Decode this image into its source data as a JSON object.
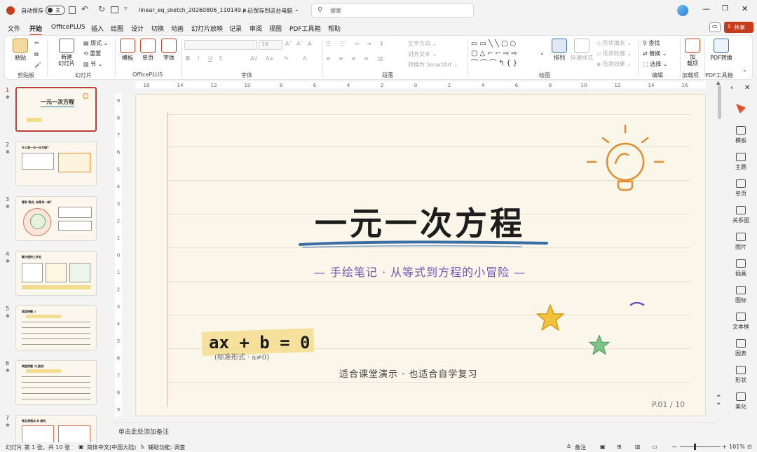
{
  "titlebar": {
    "autosave_label": "自动保存",
    "autosave_state": "关",
    "filename": "linear_eq_sketch_20260806_110149.p...",
    "save_status": "• 已保存到这台电脑",
    "search_placeholder": "搜索",
    "app_color": "#c43e1c"
  },
  "tabs": [
    "文件",
    "开始",
    "OfficePLUS",
    "插入",
    "绘图",
    "设计",
    "切换",
    "动画",
    "幻灯片放映",
    "记录",
    "审阅",
    "视图",
    "PDF工具箱",
    "帮助"
  ],
  "share_label": "共享",
  "ribbon": {
    "clipboard": {
      "paste": "粘贴",
      "group": "剪贴板"
    },
    "slides": {
      "new_slide": "新建\n幻灯片",
      "layout": "版式",
      "reset": "重置",
      "section": "节",
      "group": "幻灯片"
    },
    "officeplus": {
      "template": "模板",
      "single_page": "单页",
      "font": "字体",
      "group": "OfficePLUS"
    },
    "font": {
      "font_size": "18",
      "group": "字体"
    },
    "paragraph": {
      "text_direction": "文字方向",
      "align_text": "对齐文本",
      "smartart": "转换为 SmartArt",
      "group": "段落"
    },
    "drawing": {
      "arrange": "排列",
      "quick_styles": "快速样式",
      "shape_fill": "形状填充",
      "shape_outline": "形状轮廓",
      "shape_effects": "形状效果",
      "group": "绘图"
    },
    "editing": {
      "find": "查找",
      "replace": "替换",
      "select": "选择",
      "group": "编辑"
    },
    "addins": {
      "label": "加\n载项",
      "group": "加载项"
    },
    "pdf": {
      "label": "PDF转换",
      "group": "PDF工具箱"
    }
  },
  "thumbnails": [
    {
      "num": "1",
      "title": "一元一次方程"
    },
    {
      "num": "2",
      "title": "什么是一元一次方程?"
    },
    {
      "num": "3",
      "title": "等到 等式, 有等号一样?"
    },
    {
      "num": "4",
      "title": "解方程的三步走"
    },
    {
      "num": "5",
      "title": "典型例题 ①"
    },
    {
      "num": "6",
      "title": "典型例题 ②(进阶)"
    },
    {
      "num": "7",
      "title": "常见易错点 & 避坑"
    }
  ],
  "slide": {
    "title": "一元一次方程",
    "subtitle": "— 手绘笔记 · 从等式到方程的小冒险 —",
    "formula": "ax + b = 0",
    "formula_note": "(标准形式 · a≠0)",
    "tagline": "适合课堂演示 · 也适合自学复习",
    "page": "P.01 / 10",
    "accent_blue": "#3a6ea5",
    "accent_purple": "#6b57b5",
    "bulb_color": "#e08e2d",
    "star_yellow": "#f2c13a",
    "star_green": "#7cc48a"
  },
  "notes_placeholder": "单击此处添加备注",
  "right_panel": [
    "模板",
    "主题",
    "单页",
    "关系图",
    "图片",
    "插画",
    "图标",
    "文本框",
    "图表",
    "形状",
    "美化"
  ],
  "status": {
    "slide_info": "幻灯片 第 1 张，共 10 张",
    "language": "简体中文(中国大陆)",
    "accessibility": "辅助功能: 调查",
    "notes": "备注",
    "zoom": "101%"
  }
}
